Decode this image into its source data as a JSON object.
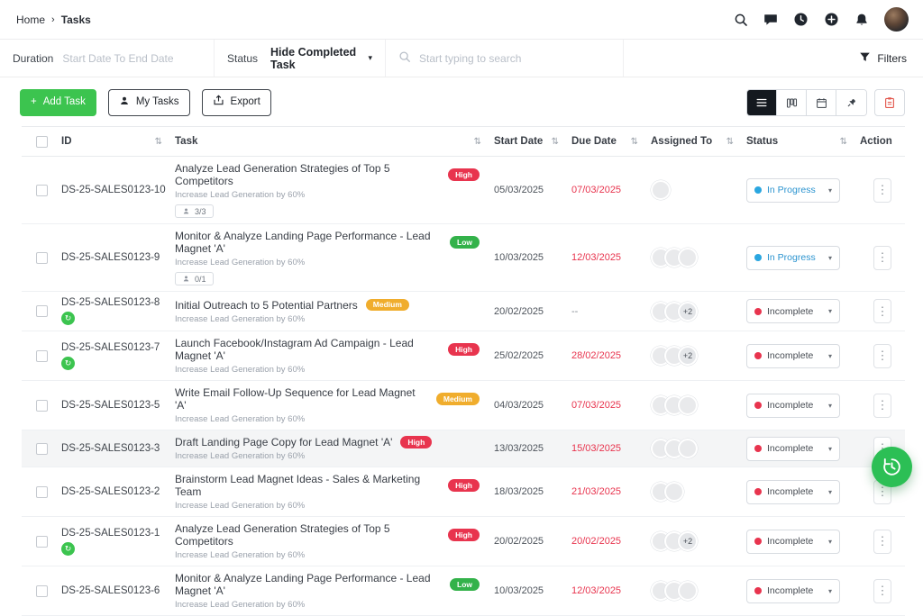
{
  "page": {
    "breadcrumb": {
      "home": "Home",
      "current": "Tasks"
    }
  },
  "filter_bar": {
    "duration_label": "Duration",
    "duration_placeholder": "Start Date To End Date",
    "status_label": "Status",
    "status_dropdown_value": "Hide Completed Task",
    "search_placeholder": "Start typing to search",
    "filters_button_label": "Filters"
  },
  "toolbar": {
    "add_task_label": "Add Task",
    "my_tasks_label": "My Tasks",
    "export_label": "Export"
  },
  "table": {
    "headers": {
      "id": "ID",
      "task": "Task",
      "start_date": "Start Date",
      "due_date": "Due Date",
      "assigned_to": "Assigned To",
      "status": "Status",
      "action": "Action"
    },
    "rows": [
      {
        "id": "DS-25-SALES0123-10",
        "recurring": false,
        "title": "Analyze Lead Generation Strategies of Top 5 Competitors",
        "priority": "High",
        "subtitle": "Increase Lead Generation by 60%",
        "subtask_count": "3/3",
        "start_date": "05/03/2025",
        "due_date": "07/03/2025",
        "due_overdue": true,
        "avatars": 1,
        "extra_assignees": "",
        "status": "In Progress",
        "highlighted": false
      },
      {
        "id": "DS-25-SALES0123-9",
        "recurring": false,
        "title": "Monitor & Analyze Landing Page Performance - Lead Magnet 'A'",
        "priority": "Low",
        "subtitle": "Increase Lead Generation by 60%",
        "subtask_count": "0/1",
        "start_date": "10/03/2025",
        "due_date": "12/03/2025",
        "due_overdue": true,
        "avatars": 3,
        "extra_assignees": "",
        "status": "In Progress",
        "highlighted": false
      },
      {
        "id": "DS-25-SALES0123-8",
        "recurring": true,
        "title": "Initial Outreach to 5 Potential Partners",
        "priority": "Medium",
        "subtitle": "Increase Lead Generation by 60%",
        "subtask_count": "",
        "start_date": "20/02/2025",
        "due_date": "--",
        "due_overdue": false,
        "avatars": 2,
        "extra_assignees": "+2",
        "status": "Incomplete",
        "highlighted": false
      },
      {
        "id": "DS-25-SALES0123-7",
        "recurring": true,
        "title": "Launch Facebook/Instagram Ad Campaign - Lead Magnet 'A'",
        "priority": "High",
        "subtitle": "Increase Lead Generation by 60%",
        "subtask_count": "",
        "start_date": "25/02/2025",
        "due_date": "28/02/2025",
        "due_overdue": true,
        "avatars": 2,
        "extra_assignees": "+2",
        "status": "Incomplete",
        "highlighted": false
      },
      {
        "id": "DS-25-SALES0123-5",
        "recurring": false,
        "title": "Write Email Follow-Up Sequence for Lead Magnet 'A'",
        "priority": "Medium",
        "subtitle": "Increase Lead Generation by 60%",
        "subtask_count": "",
        "start_date": "04/03/2025",
        "due_date": "07/03/2025",
        "due_overdue": true,
        "avatars": 3,
        "extra_assignees": "",
        "status": "Incomplete",
        "highlighted": false
      },
      {
        "id": "DS-25-SALES0123-3",
        "recurring": false,
        "title": "Draft Landing Page Copy for Lead Magnet 'A'",
        "priority": "High",
        "subtitle": "Increase Lead Generation by 60%",
        "subtask_count": "",
        "start_date": "13/03/2025",
        "due_date": "15/03/2025",
        "due_overdue": true,
        "avatars": 3,
        "extra_assignees": "",
        "status": "Incomplete",
        "highlighted": true
      },
      {
        "id": "DS-25-SALES0123-2",
        "recurring": false,
        "title": "Brainstorm Lead Magnet Ideas - Sales & Marketing Team",
        "priority": "High",
        "subtitle": "Increase Lead Generation by 60%",
        "subtask_count": "",
        "start_date": "18/03/2025",
        "due_date": "21/03/2025",
        "due_overdue": true,
        "avatars": 2,
        "extra_assignees": "",
        "status": "Incomplete",
        "highlighted": false
      },
      {
        "id": "DS-25-SALES0123-1",
        "recurring": true,
        "title": "Analyze Lead Generation Strategies of Top 5 Competitors",
        "priority": "High",
        "subtitle": "Increase Lead Generation by 60%",
        "subtask_count": "",
        "start_date": "20/02/2025",
        "due_date": "20/02/2025",
        "due_overdue": true,
        "avatars": 2,
        "extra_assignees": "+2",
        "status": "Incomplete",
        "highlighted": false
      },
      {
        "id": "DS-25-SALES0123-6",
        "recurring": false,
        "title": "Monitor & Analyze Landing Page Performance - Lead Magnet 'A'",
        "priority": "Low",
        "subtitle": "Increase Lead Generation by 60%",
        "subtask_count": "",
        "start_date": "10/03/2025",
        "due_date": "12/03/2025",
        "due_overdue": true,
        "avatars": 3,
        "extra_assignees": "",
        "status": "Incomplete",
        "highlighted": false
      }
    ]
  },
  "icons": {
    "breadcrumb_separator": "›",
    "caret_down": "▾",
    "sort": "⇅",
    "ellipsis": "⋮",
    "recurring": "↻",
    "plus": "+"
  },
  "colors": {
    "priority_high": "#e8344e",
    "priority_medium": "#f0ad2d",
    "priority_low": "#33b24a",
    "status_in_progress": "#2aa6e0",
    "status_in_progress_text": "#2a93cf",
    "status_incomplete": "#e8344e",
    "overdue_red": "#e8344e",
    "accent_green": "#3cc44f"
  }
}
